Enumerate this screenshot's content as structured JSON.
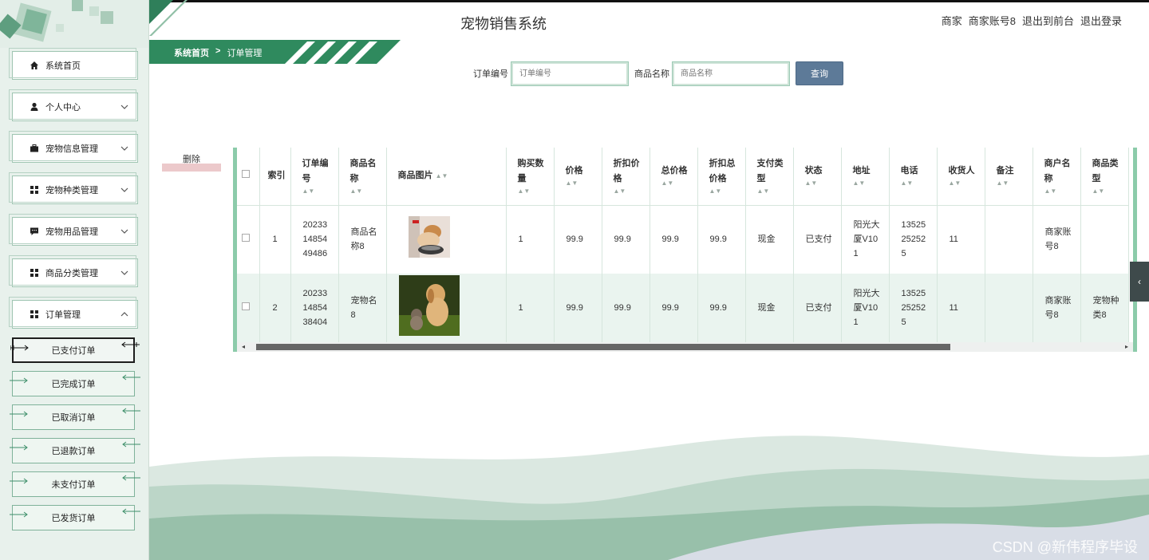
{
  "app": {
    "title": "宠物销售系统",
    "user_role": "商家",
    "user_name": "商家账号8",
    "link_front": "退出到前台",
    "link_logout": "退出登录"
  },
  "sidebar": {
    "items": [
      {
        "label": "系统首页",
        "icon": "home-icon"
      },
      {
        "label": "个人中心",
        "icon": "user-icon"
      },
      {
        "label": "宠物信息管理",
        "icon": "briefcase-icon"
      },
      {
        "label": "宠物种类管理",
        "icon": "grid-icon"
      },
      {
        "label": "宠物用品管理",
        "icon": "message-icon"
      },
      {
        "label": "商品分类管理",
        "icon": "grid-icon"
      },
      {
        "label": "订单管理",
        "icon": "grid-icon"
      }
    ],
    "sub_items": [
      "已支付订单",
      "已完成订单",
      "已取消订单",
      "已退款订单",
      "未支付订单",
      "已发货订单"
    ]
  },
  "breadcrumb": {
    "home": "系统首页",
    "sep": ">",
    "current": "订单管理"
  },
  "search": {
    "order_label": "订单编号",
    "order_placeholder": "订单编号",
    "product_label": "商品名称",
    "product_placeholder": "商品名称",
    "button": "查询"
  },
  "toolbar": {
    "delete": "删除"
  },
  "table": {
    "headers": [
      "索引",
      "订单编号",
      "商品名称",
      "商品图片",
      "购买数量",
      "价格",
      "折扣价格",
      "总价格",
      "折扣总价格",
      "支付类型",
      "状态",
      "地址",
      "电话",
      "收货人",
      "备注",
      "商户名称",
      "商品类型"
    ],
    "rows": [
      {
        "index": "1",
        "order_no": "20233148544948​6",
        "product": "商品名称8",
        "image": "cat-eating-photo",
        "qty": "1",
        "price": "99.9",
        "discount_price": "99.9",
        "total": "99.9",
        "discount_total": "99.9",
        "pay_type": "现金",
        "status": "已支付",
        "address": "阳光大厦V101",
        "phone": "13525252525",
        "receiver": "11",
        "note": "",
        "merchant": "商家账号8",
        "category": ""
      },
      {
        "index": "2",
        "order_no": "202331485438404",
        "product": "宠物名8",
        "image": "dog-and-cat-photo",
        "qty": "1",
        "price": "99.9",
        "discount_price": "99.9",
        "total": "99.9",
        "discount_total": "99.9",
        "pay_type": "现金",
        "status": "已支付",
        "address": "阳光大厦V101",
        "phone": "13525252525",
        "receiver": "11",
        "note": "",
        "merchant": "商家账号8",
        "category": "宠物种类8"
      }
    ]
  },
  "colors": {
    "accent": "#2f8a5e",
    "button": "#5d7a98",
    "row_alt": "#eaf4ef"
  },
  "watermark": "CSDN @新伟程序毕设"
}
